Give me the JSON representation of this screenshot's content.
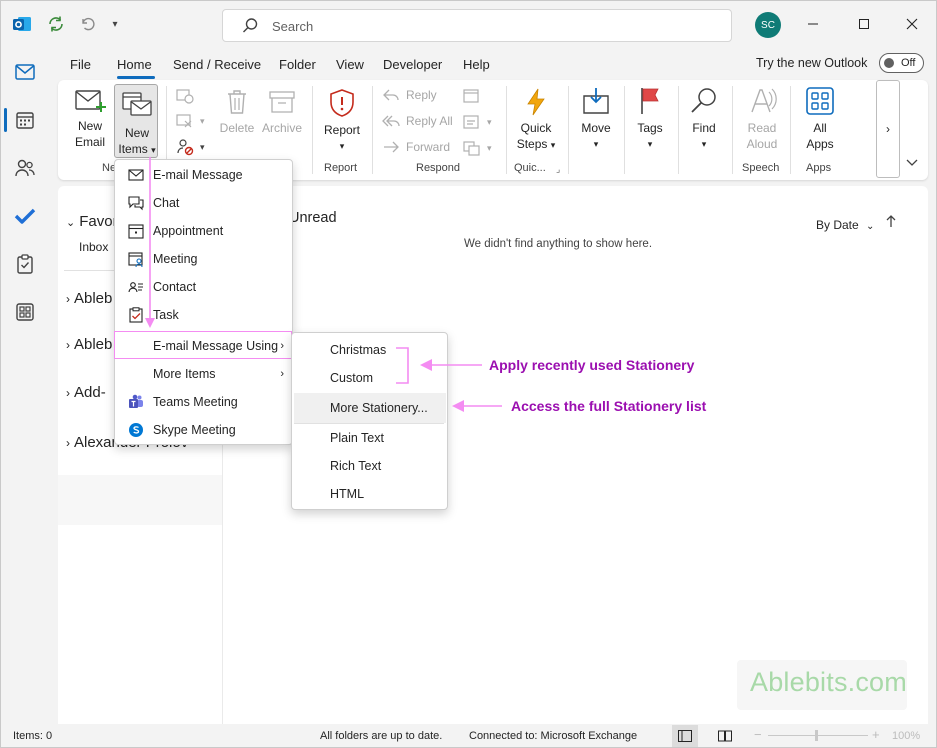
{
  "titlebar": {
    "search_placeholder": "Search",
    "avatar_initials": "SC",
    "app_icon": "outlook-logo-icon"
  },
  "tabs": [
    "File",
    "Home",
    "Send / Receive",
    "Folder",
    "View",
    "Developer",
    "Help"
  ],
  "active_tab": "Home",
  "try_new": {
    "label": "Try the new Outlook",
    "toggle_label": "Off"
  },
  "ribbon": {
    "new_email": [
      "New",
      "Email"
    ],
    "new_items": [
      "New",
      "Items"
    ],
    "delete": "Delete",
    "archive": "Archive",
    "report": "Report",
    "reply": "Reply",
    "reply_all": "Reply All",
    "forward": "Forward",
    "quick_steps": [
      "Quick",
      "Steps"
    ],
    "move": "Move",
    "tags": "Tags",
    "find": "Find",
    "read_aloud": [
      "Read",
      "Aloud"
    ],
    "all_apps": [
      "All",
      "Apps"
    ],
    "more": "›",
    "groups": {
      "new": "Ne",
      "report": "Report",
      "respond": "Respond",
      "quick": "Quic...",
      "speech": "Speech",
      "apps": "Apps"
    }
  },
  "folder_pane": {
    "favorites": "Favor",
    "inbox": "Inbox",
    "items": [
      "Ableb",
      "Ableb",
      "Add-",
      "Alexander Prolov"
    ]
  },
  "message_list": {
    "filter": "Unread",
    "sort": "By Date",
    "empty": "We didn't find anything to show here."
  },
  "new_items_menu": [
    {
      "label": "E-mail Message",
      "icon": "mail-icon"
    },
    {
      "label": "Chat",
      "icon": "chat-icon"
    },
    {
      "label": "Appointment",
      "icon": "appointment-icon"
    },
    {
      "label": "Meeting",
      "icon": "meeting-icon"
    },
    {
      "label": "Contact",
      "icon": "contact-icon"
    },
    {
      "label": "Task",
      "icon": "task-icon"
    },
    {
      "label": "E-mail Message Using",
      "submenu": true
    },
    {
      "label": "More Items",
      "submenu": true
    },
    {
      "label": "Teams Meeting",
      "icon": "teams-icon"
    },
    {
      "label": "Skype Meeting",
      "icon": "skype-icon"
    }
  ],
  "stationery_menu": [
    "Christmas",
    "Custom",
    "More Stationery...",
    "Plain Text",
    "Rich Text",
    "HTML"
  ],
  "annotations": {
    "recent": "Apply recently used Stationery",
    "full": "Access the full Stationery list"
  },
  "watermark": "Ablebits.com",
  "statusbar": {
    "items": "Items: 0",
    "sync": "All folders are up to date.",
    "connection": "Connected to: Microsoft Exchange",
    "zoom": "100%"
  },
  "colors": {
    "accent": "#0f6cbd",
    "annotation": "#9b0fb0",
    "annotation_line": "#f48cf2",
    "avatar": "#0f7b76"
  }
}
